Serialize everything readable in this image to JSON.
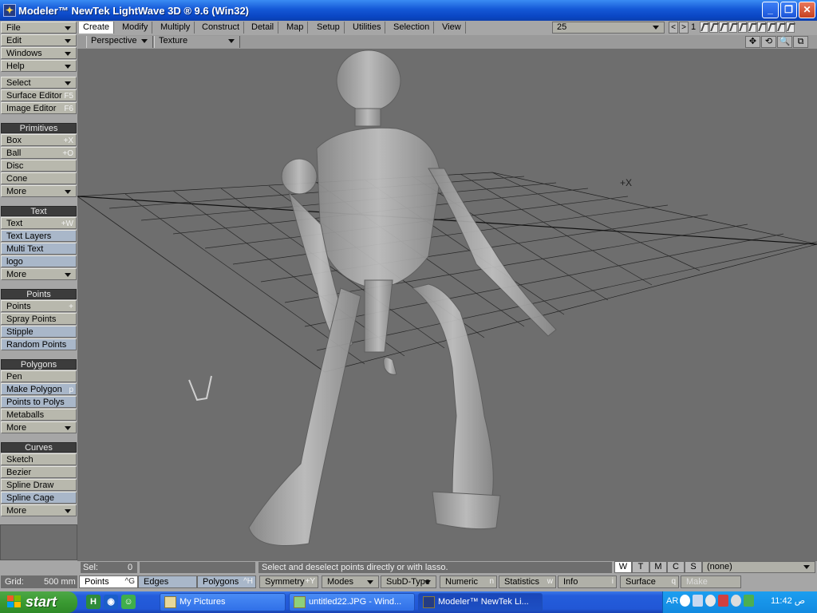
{
  "window": {
    "title": "Modeler™ NewTek LightWave 3D ® 9.6  (Win32)",
    "icon": "lightwave-icon"
  },
  "left_menus": [
    "File",
    "Edit",
    "Windows",
    "Help"
  ],
  "left_tools_top": [
    {
      "label": "Select",
      "dropdown": true
    },
    {
      "label": "Surface Editor",
      "shortcut": "F5"
    },
    {
      "label": "Image Editor",
      "shortcut": "F6"
    }
  ],
  "primitives": {
    "header": "Primitives",
    "items": [
      {
        "label": "Box",
        "shortcut": "+X"
      },
      {
        "label": "Ball",
        "shortcut": "+O"
      },
      {
        "label": "Disc",
        "shortcut": ""
      },
      {
        "label": "Cone",
        "shortcut": ""
      },
      {
        "label": "More",
        "dropdown": true
      }
    ]
  },
  "text_group": {
    "header": "Text",
    "items": [
      {
        "label": "Text",
        "shortcut": "+W"
      },
      {
        "label": "Text Layers",
        "shortcut": ""
      },
      {
        "label": "Multi Text",
        "shortcut": ""
      },
      {
        "label": "logo",
        "shortcut": ""
      },
      {
        "label": "More",
        "dropdown": true
      }
    ]
  },
  "points_group": {
    "header": "Points",
    "items": [
      {
        "label": "Points",
        "shortcut": "+"
      },
      {
        "label": "Spray Points",
        "shortcut": ""
      },
      {
        "label": "Stipple",
        "shortcut": ""
      },
      {
        "label": "Random Points",
        "shortcut": ""
      }
    ]
  },
  "polygons_group": {
    "header": "Polygons",
    "items": [
      {
        "label": "Pen",
        "shortcut": ""
      },
      {
        "label": "Make Polygon",
        "shortcut": "p"
      },
      {
        "label": "Points to Polys",
        "shortcut": ""
      },
      {
        "label": "Metaballs",
        "shortcut": ""
      },
      {
        "label": "More",
        "dropdown": true
      }
    ]
  },
  "curves_group": {
    "header": "Curves",
    "items": [
      {
        "label": "Sketch",
        "shortcut": ""
      },
      {
        "label": "Bezier",
        "shortcut": ""
      },
      {
        "label": "Spline Draw",
        "shortcut": ""
      },
      {
        "label": "Spline Cage",
        "shortcut": ""
      },
      {
        "label": "More",
        "dropdown": true
      }
    ]
  },
  "tabs": [
    "Create",
    "Modify",
    "Multiply",
    "Construct",
    "Detail",
    "Map",
    "Setup",
    "Utilities",
    "Selection",
    "View"
  ],
  "active_tab": "Create",
  "layer_select": "25",
  "layer_nav": {
    "prev": "<",
    "next": ">"
  },
  "layer_number": "1",
  "viewport": {
    "view_mode": "Perspective",
    "render_mode": "Texture",
    "icons": [
      "move-icon",
      "rotate-icon",
      "zoom-icon",
      "maximize-icon"
    ],
    "icon_glyphs": [
      "✥",
      "⟲",
      "🔍",
      "⧉"
    ]
  },
  "status": {
    "sel_label": "Sel:",
    "sel_value": "0",
    "hint": "Select and deselect points directly or with lasso.",
    "wtmcs": [
      "W",
      "T",
      "M",
      "C",
      "S"
    ],
    "wtmcs_active": "W",
    "vmap": "(none)"
  },
  "bottom": {
    "grid_label": "Grid:",
    "grid_value": "500 mm",
    "modes": [
      {
        "label": "Points",
        "shortcut": "^G"
      },
      {
        "label": "Edges",
        "shortcut": ""
      },
      {
        "label": "Polygons",
        "shortcut": "^H"
      }
    ],
    "symmetry": {
      "label": "Symmetry",
      "shortcut": "+Y"
    },
    "modes_dropdown": "Modes",
    "subd": "SubD-Type",
    "numeric": {
      "label": "Numeric",
      "shortcut": "n"
    },
    "statistics": {
      "label": "Statistics",
      "shortcut": "w"
    },
    "info": {
      "label": "Info",
      "shortcut": "i"
    },
    "surface": {
      "label": "Surface",
      "shortcut": "q"
    },
    "make": "Make"
  },
  "taskbar": {
    "start": "start",
    "quick_launch": [
      "quicktime-icon",
      "media-player-icon",
      "messenger-icon"
    ],
    "buttons": [
      {
        "label": "My Pictures",
        "active": false
      },
      {
        "label": "untitled22.JPG - Wind...",
        "active": false
      },
      {
        "label": "Modeler™ NewTek Li...",
        "active": true
      }
    ],
    "lang": "AR",
    "clock": "11:42 ص"
  }
}
